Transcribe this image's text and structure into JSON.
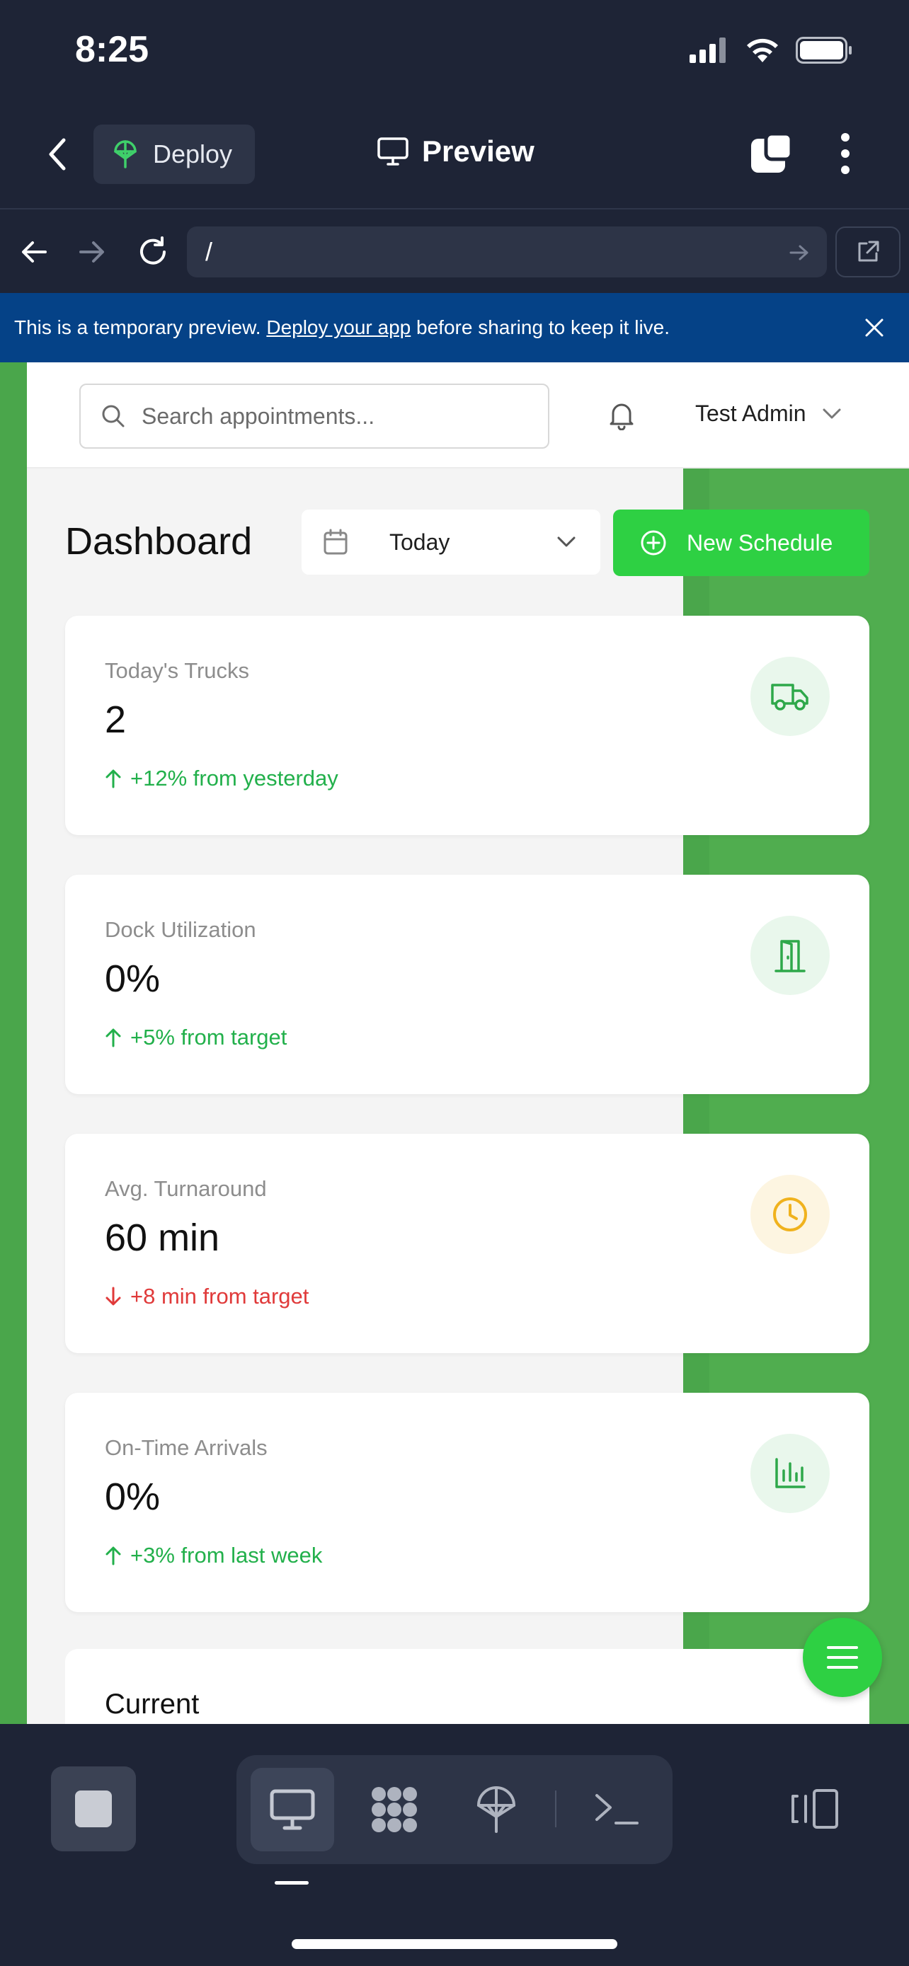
{
  "status_bar": {
    "time": "8:25"
  },
  "app_bar": {
    "deploy_label": "Deploy",
    "title": "Preview"
  },
  "browser": {
    "url": "/"
  },
  "banner": {
    "text_before": "This is a temporary preview. ",
    "link": "Deploy your app",
    "text_after": " before sharing to keep it live."
  },
  "header": {
    "search_placeholder": "Search appointments...",
    "user_name": "Test Admin"
  },
  "dashboard": {
    "title": "Dashboard",
    "date_filter": "Today",
    "new_button": "New Schedule"
  },
  "stats": [
    {
      "label": "Today's Trucks",
      "value": "2",
      "change": "+12% from yesterday",
      "direction": "up",
      "icon": "truck-icon"
    },
    {
      "label": "Dock Utilization",
      "value": "0%",
      "change": "+5% from target",
      "direction": "up",
      "icon": "door-icon"
    },
    {
      "label": "Avg. Turnaround",
      "value": "60 min",
      "change": "+8 min from target",
      "direction": "down",
      "icon": "clock-icon"
    },
    {
      "label": "On-Time Arrivals",
      "value": "0%",
      "change": "+3% from last week",
      "direction": "up",
      "icon": "bar-chart-icon"
    }
  ],
  "partial_card": {
    "title": "Current"
  },
  "colors": {
    "accent_green": "#2ed043",
    "banner_blue": "#054287",
    "positive": "#22b04b",
    "negative": "#e03a3a",
    "warning": "#f0b21d"
  }
}
